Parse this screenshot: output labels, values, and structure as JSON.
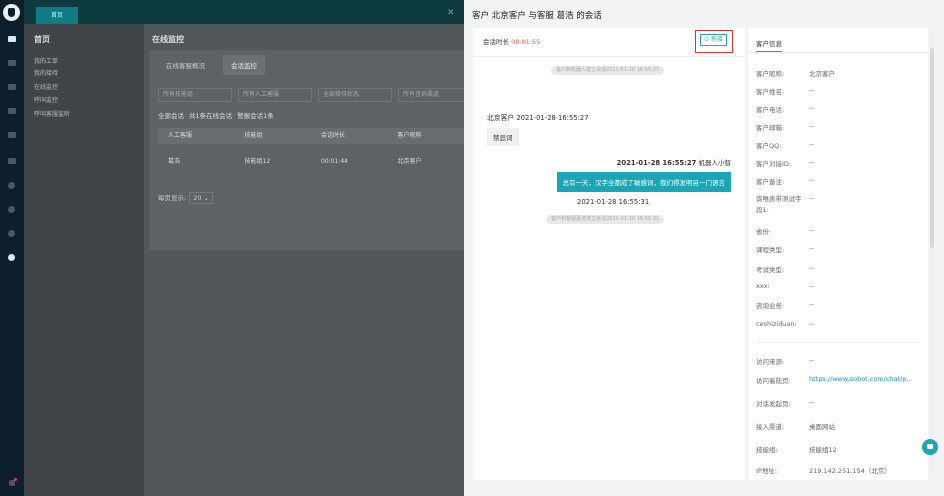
{
  "topbar": {
    "home_tab": "首页"
  },
  "nav": {
    "title": "首页",
    "items": [
      "我的工单",
      "我的接待",
      "在线监控",
      "呼叫监控",
      "呼叫客服监听"
    ]
  },
  "main": {
    "title": "在线监控",
    "tabs": [
      "在线客服概况",
      "会话监控"
    ],
    "filters": [
      "所有技能组",
      "所有人工客服",
      "全部接待状态",
      "所有咨询渠道"
    ],
    "counts": {
      "all": "全部会话",
      "online": "共1条在线会话",
      "alert": "警报会话1条"
    },
    "table": {
      "headers": [
        "人工客服",
        "技能组",
        "会话时长",
        "客户昵称"
      ],
      "row": [
        "葛浩",
        "技能组12",
        "00:01:44",
        "北京客户"
      ]
    },
    "pager": {
      "label": "每页显示:",
      "value": "20"
    }
  },
  "drawer": {
    "title": "客户 北京客户 与客服 葛浩 的会话",
    "duration_label": "会话时长",
    "duration_value": "00:01:55",
    "pickup_label": "⊙ 抢接",
    "messages": {
      "sys1": "客户和机器人建立会话2021-01-28 16:55:27",
      "customer_head": "北京客户 2021-01-28 16:55:27",
      "customer_msg": "禁忌词",
      "bot_time": "2021-01-28 16:55:27",
      "bot_name": "机器人小智",
      "bot_msg": "总有一天，汉字全都成了敏感词，我们得发明另一门语言",
      "time2": "2021-01-28 16:55:31",
      "sys2": "客户和客服葛浩建立会话2021-01-28 16:55:31"
    },
    "info_tab": "客户信息",
    "info_rows": [
      {
        "k": "客户昵称:",
        "v": "北京客户"
      },
      {
        "k": "客户姓名:",
        "v": "--"
      },
      {
        "k": "客户电话:",
        "v": "--"
      },
      {
        "k": "客户邮箱:",
        "v": "--"
      },
      {
        "k": "客户QQ:",
        "v": "--"
      },
      {
        "k": "客户对接ID:",
        "v": "--"
      },
      {
        "k": "客户备注:",
        "v": "--"
      },
      {
        "k": "询唯表带测试字段1:",
        "v": "--"
      },
      {
        "k": "省份:",
        "v": "--"
      },
      {
        "k": "课程类型:",
        "v": "--"
      },
      {
        "k": "考试类型:",
        "v": "--"
      },
      {
        "k": "xxx:",
        "v": "--"
      },
      {
        "k": "咨询业务:",
        "v": "--"
      },
      {
        "k": "ceshiziduan:",
        "v": "--"
      }
    ],
    "info_rows2": [
      {
        "k": "访问来源:",
        "v": "--"
      },
      {
        "k": "访问着陆页:",
        "v": "https://www.sobot.com/chat/p..."
      },
      {
        "k": "对话发起页:",
        "v": "--"
      },
      {
        "k": "接入渠道:",
        "v": "桌面网站"
      },
      {
        "k": "技能组:",
        "v": "技能组12"
      },
      {
        "k": "IP地址:",
        "v": "219.142.251.154（北京）"
      }
    ]
  }
}
